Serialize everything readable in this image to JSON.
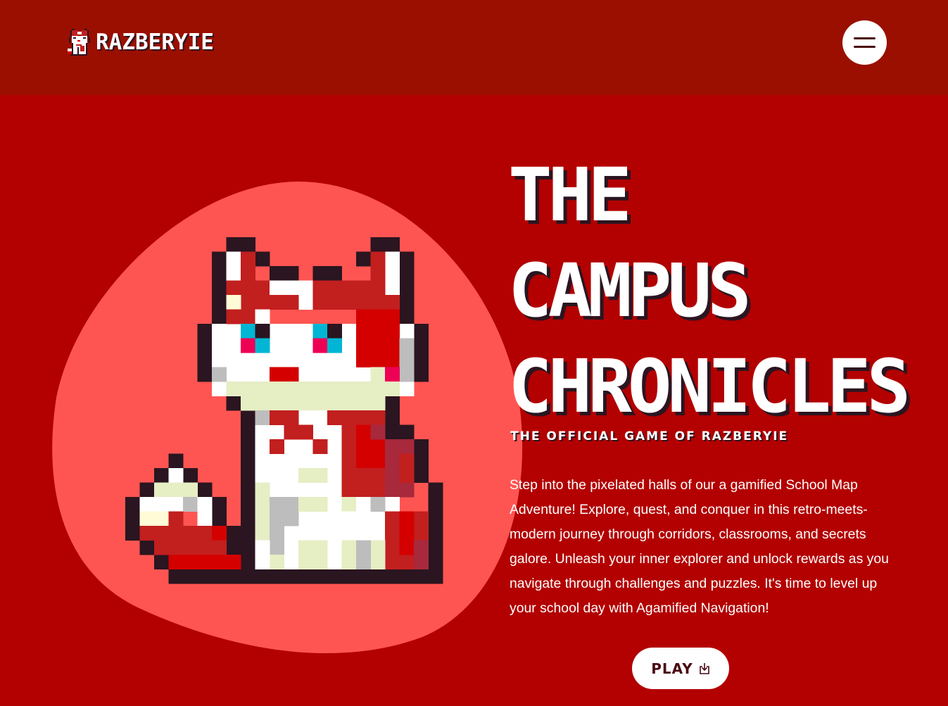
{
  "header": {
    "brand": "RAZBERYIE",
    "logo_icon": "fox-mascot-icon",
    "menu_icon": "hamburger-menu-icon"
  },
  "hero": {
    "title_lines": [
      "THE",
      "CAMPUS",
      "CHRONICLES"
    ],
    "subtitle": "THE OFFICIAL GAME OF RAZBERYIE",
    "description": "Step into the pixelated halls of our a gamified School Map Adventure! Explore, quest, and conquer in this retro-meets-modern journey through corridors, classrooms, and secrets galore. Unleash your inner explorer and unlock rewards as you navigate through challenges and puzzles. It's time to level up your school day with Agamified Navigation!",
    "play_label": "PLAY",
    "play_icon": "download-icon",
    "mascot": "pixel-fox-mascot-illustration"
  },
  "colors": {
    "header_bg": "#9a0f00",
    "hero_bg": "#b30000",
    "blob": "#ff5552",
    "outline": "#2a1520",
    "button_text": "#4a0a14"
  }
}
